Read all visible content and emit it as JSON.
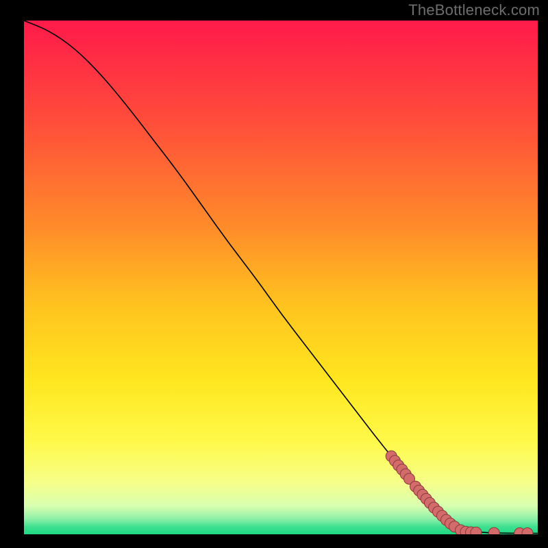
{
  "attribution": "TheBottleneck.com",
  "chart_data": {
    "type": "line",
    "title": "",
    "xlabel": "",
    "ylabel": "",
    "x_range": [
      0,
      100
    ],
    "y_range": [
      0,
      100
    ],
    "curve": [
      {
        "x": 0,
        "y": 100
      },
      {
        "x": 5,
        "y": 98
      },
      {
        "x": 10,
        "y": 94.5
      },
      {
        "x": 15,
        "y": 89.5
      },
      {
        "x": 20,
        "y": 83.5
      },
      {
        "x": 25,
        "y": 77
      },
      {
        "x": 30,
        "y": 70.5
      },
      {
        "x": 35,
        "y": 63.5
      },
      {
        "x": 40,
        "y": 56.5
      },
      {
        "x": 45,
        "y": 50
      },
      {
        "x": 50,
        "y": 43
      },
      {
        "x": 55,
        "y": 36.5
      },
      {
        "x": 60,
        "y": 30
      },
      {
        "x": 65,
        "y": 23.5
      },
      {
        "x": 70,
        "y": 17
      },
      {
        "x": 75,
        "y": 11
      },
      {
        "x": 80,
        "y": 5.5
      },
      {
        "x": 84,
        "y": 2
      },
      {
        "x": 87,
        "y": 0.6
      },
      {
        "x": 90,
        "y": 0.3
      },
      {
        "x": 95,
        "y": 0.2
      },
      {
        "x": 100,
        "y": 0.2
      }
    ],
    "markers": [
      {
        "x": 71.5,
        "y": 15.2
      },
      {
        "x": 72.2,
        "y": 14.3
      },
      {
        "x": 72.9,
        "y": 13.4
      },
      {
        "x": 73.6,
        "y": 12.6
      },
      {
        "x": 74.3,
        "y": 11.7
      },
      {
        "x": 75.0,
        "y": 10.8
      },
      {
        "x": 76.2,
        "y": 9.3
      },
      {
        "x": 76.9,
        "y": 8.5
      },
      {
        "x": 77.6,
        "y": 7.7
      },
      {
        "x": 78.3,
        "y": 6.9
      },
      {
        "x": 79.0,
        "y": 6.1
      },
      {
        "x": 79.8,
        "y": 5.2
      },
      {
        "x": 80.6,
        "y": 4.4
      },
      {
        "x": 81.4,
        "y": 3.6
      },
      {
        "x": 82.2,
        "y": 2.8
      },
      {
        "x": 83.0,
        "y": 2.1
      },
      {
        "x": 83.8,
        "y": 1.5
      },
      {
        "x": 85.0,
        "y": 0.8
      },
      {
        "x": 86.0,
        "y": 0.5
      },
      {
        "x": 87.0,
        "y": 0.4
      },
      {
        "x": 88.0,
        "y": 0.35
      },
      {
        "x": 91.5,
        "y": 0.25
      },
      {
        "x": 96.5,
        "y": 0.2
      },
      {
        "x": 98.0,
        "y": 0.2
      }
    ],
    "marker_style": {
      "fill": "#d36b6b",
      "stroke": "#8a3a3a",
      "radius_px": 8
    },
    "gradient_stops": [
      {
        "offset": 0.0,
        "color": "#ff1a4a"
      },
      {
        "offset": 0.2,
        "color": "#ff4e3a"
      },
      {
        "offset": 0.4,
        "color": "#ff8b2a"
      },
      {
        "offset": 0.55,
        "color": "#ffc21f"
      },
      {
        "offset": 0.7,
        "color": "#ffe61f"
      },
      {
        "offset": 0.82,
        "color": "#fff94a"
      },
      {
        "offset": 0.9,
        "color": "#f6ff8a"
      },
      {
        "offset": 0.945,
        "color": "#d8ffb0"
      },
      {
        "offset": 0.97,
        "color": "#8ff0a8"
      },
      {
        "offset": 0.985,
        "color": "#3fe08f"
      },
      {
        "offset": 1.0,
        "color": "#1fd884"
      }
    ]
  }
}
